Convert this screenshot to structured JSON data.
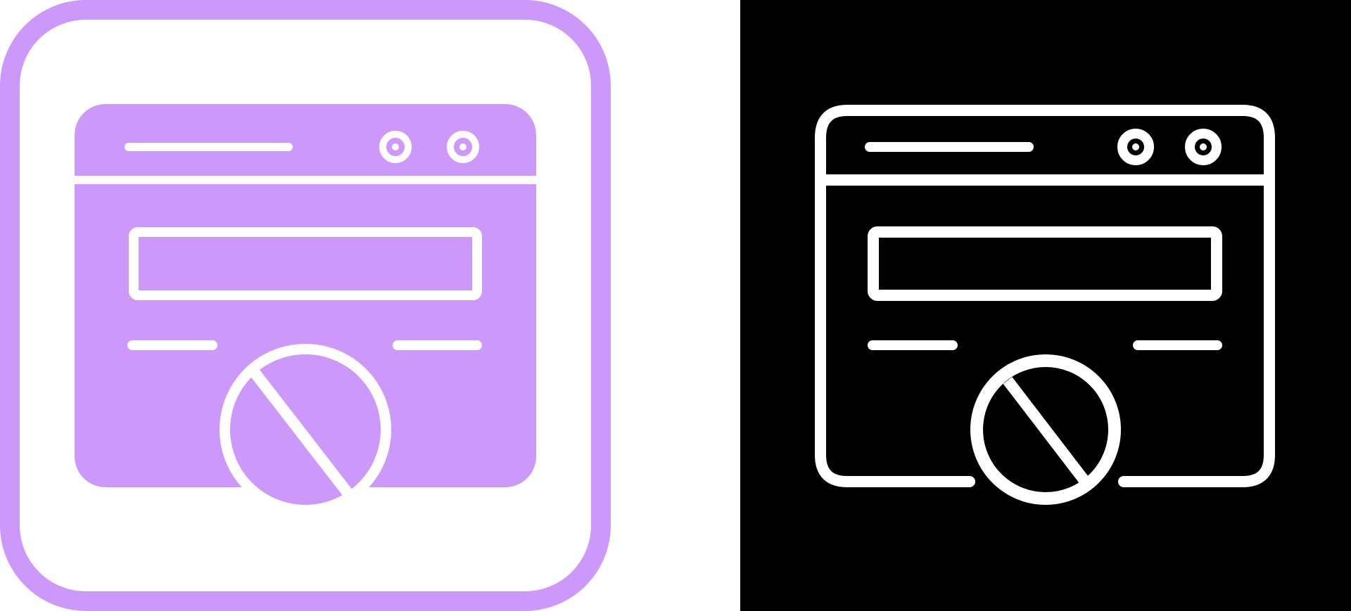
{
  "icons": [
    {
      "variant": "filled",
      "semantic": "blocked-website-icon",
      "palette": {
        "frame": "#cc99fa",
        "fill": "#cc99fa",
        "stroke": "#ffffff",
        "background": "#ffffff"
      }
    },
    {
      "variant": "outline",
      "semantic": "blocked-website-icon",
      "palette": {
        "frame": "none",
        "fill": "#000000",
        "stroke": "#ffffff",
        "background": "#000000"
      }
    }
  ]
}
